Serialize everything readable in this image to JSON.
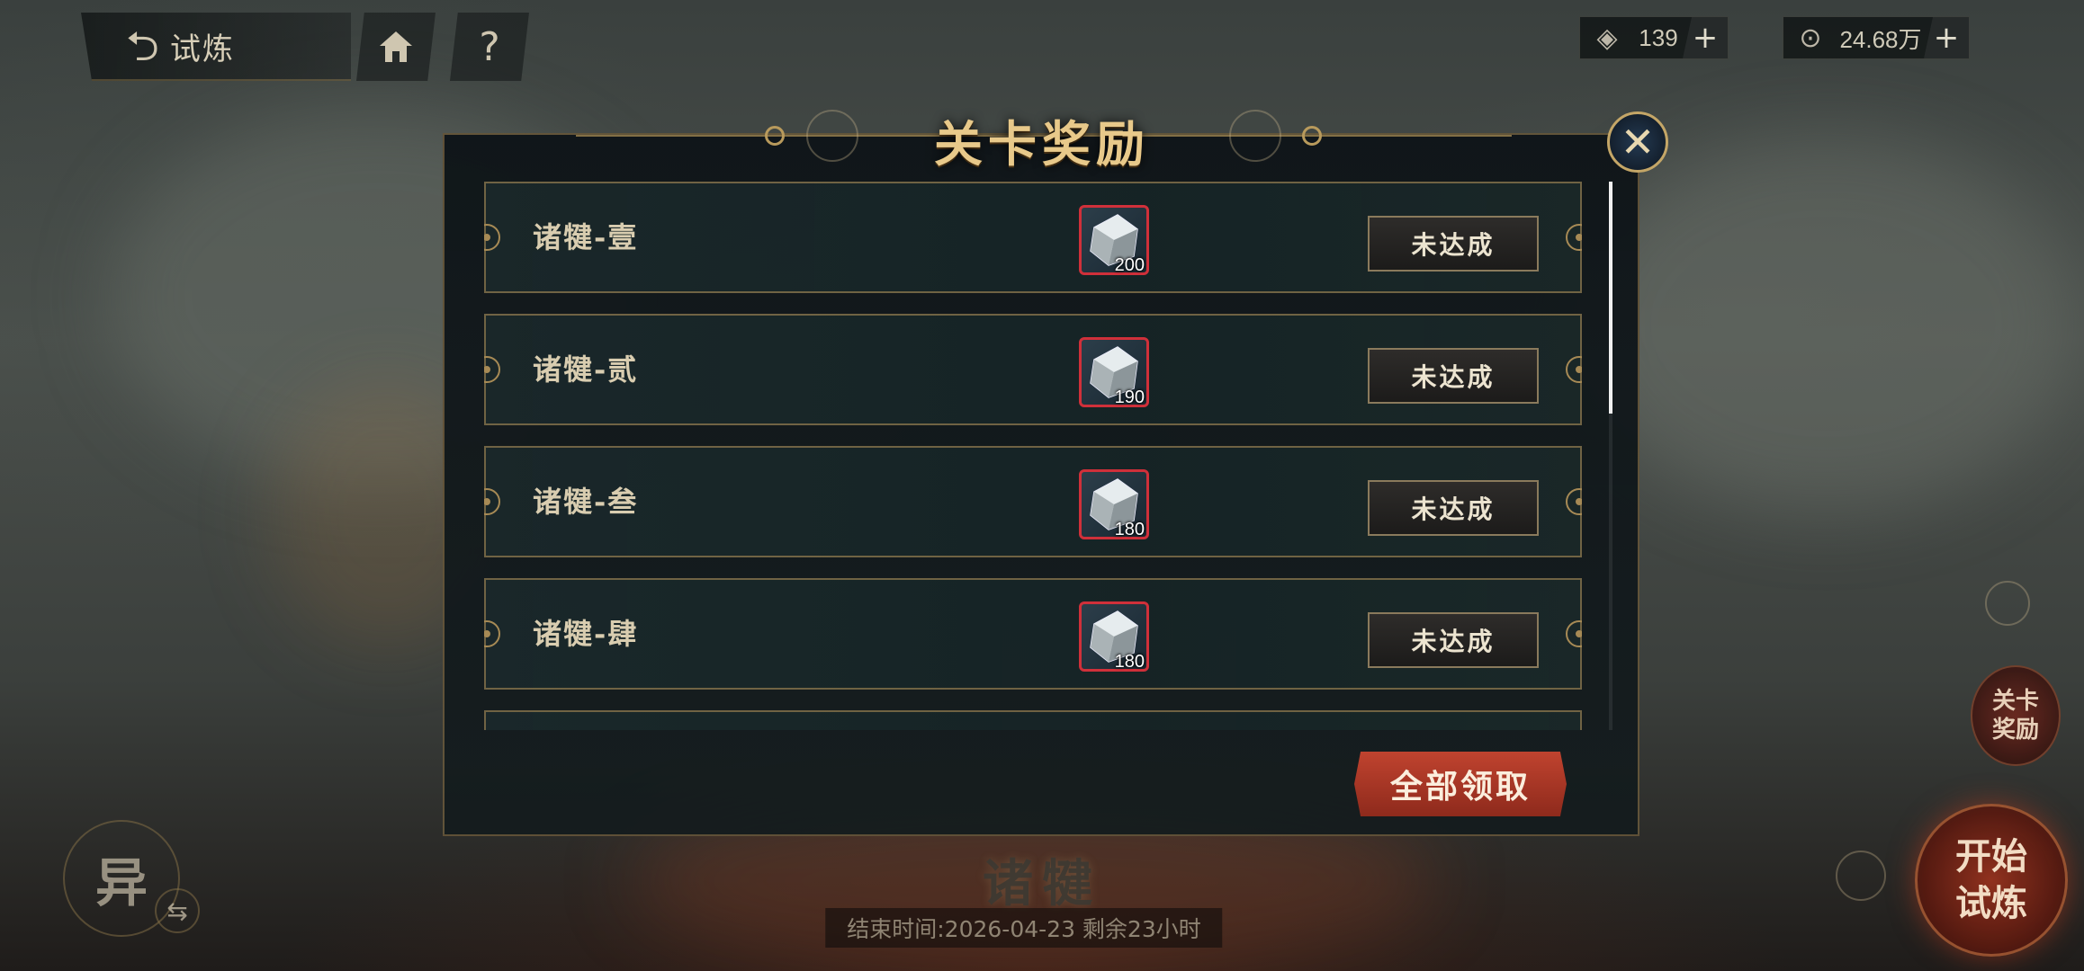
{
  "top_bar": {
    "back_label": "试炼",
    "home_icon": "home-icon",
    "help_label": "?",
    "currencies": [
      {
        "icon": "gem-icon",
        "value": "139",
        "plus": "+"
      },
      {
        "icon": "coin-icon",
        "value": "24.68万",
        "plus": "+"
      }
    ]
  },
  "modal": {
    "title": "关卡奖励",
    "close_label": "✕",
    "rows": [
      {
        "name": "诸犍-壹",
        "reward_count": "200",
        "status": "未达成"
      },
      {
        "name": "诸犍-贰",
        "reward_count": "190",
        "status": "未达成"
      },
      {
        "name": "诸犍-叁",
        "reward_count": "180",
        "status": "未达成"
      },
      {
        "name": "诸犍-肆",
        "reward_count": "180",
        "status": "未达成"
      }
    ],
    "claim_all_label": "全部领取",
    "scroll_position": 0
  },
  "bottom": {
    "stage_name": "诸犍",
    "end_time": "结束时间:2026-04-23 剩余23小时",
    "left_char": "异",
    "swap_icon": "swap-icon"
  },
  "side_buttons": {
    "stage_reward_line1": "关卡",
    "stage_reward_line2": "奖励",
    "start_line1": "开始",
    "start_line2": "试炼"
  },
  "colors": {
    "accent_gold": "#e8c98a",
    "reward_border": "#d0303a",
    "claim_button": "#c0432f"
  }
}
